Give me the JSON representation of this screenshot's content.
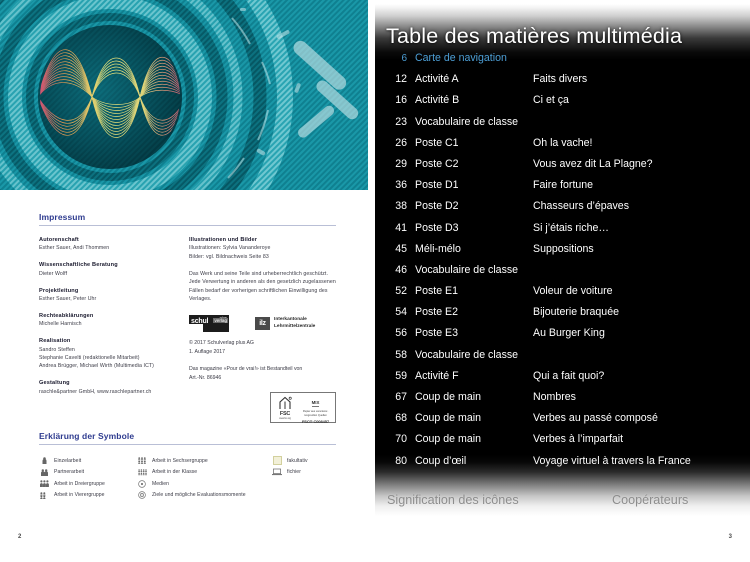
{
  "spread": {
    "left_page_number": "2",
    "right_page_number": "3"
  },
  "left_page": {
    "hero": {
      "alt": "abstract teal concentric circles with coloured sound waves"
    },
    "impressum": {
      "title": "Impressum",
      "column_left": [
        {
          "heading": "Autorenschaft",
          "lines": [
            "Esther Sauer, Andi Thommen"
          ]
        },
        {
          "heading": "Wissenschaftliche Beratung",
          "lines": [
            "Dieter Wolff"
          ]
        },
        {
          "heading": "Projektleitung",
          "lines": [
            "Esther Sauer, Peter Uhr"
          ]
        },
        {
          "heading": "Rechteabklärungen",
          "lines": [
            "Michelle Harnisch"
          ]
        },
        {
          "heading": "Realisation",
          "lines": [
            "Sandro Steffen",
            "Stephanie Cavelti (redaktionelle Mitarbeit)",
            "Andrea Brügger, Michael Wirth (Multimedia ICT)"
          ]
        },
        {
          "heading": "Gestaltung",
          "lines": [
            "raschle&partner GmbH, www.raschlepartner.ch"
          ]
        }
      ],
      "column_right": {
        "heading": "Illustrationen und Bilder",
        "lines": [
          "Illustrationen: Sylvia Vananderoye",
          "Bilder: vgl. Bildnachweis Seite 83"
        ],
        "copyright_notice": "Das Werk und seine Teile sind urheberrechtlich geschützt. Jede Verwertung in anderen als den gesetzlich zugelassenen Fällen bedarf der vorherigen schriftlichen Einwilligung des Verlages.",
        "logos": {
          "schulverlag": {
            "word": "schul",
            "tag": "verlag",
            "plus": "plus"
          },
          "ilz": {
            "mark": "ilz",
            "line1": "Interkantonale",
            "line2": "Lehrmittelzentrale"
          }
        },
        "copyright_lines": [
          "© 2017 Schulverlag plus AG",
          "1. Auflage 2017"
        ],
        "magazine_lines": [
          "Das magazine «Pour de vrai!» ist Bestandteil von",
          "Art.-Nr. 86946"
        ],
        "fsc": {
          "name": "FSC",
          "sub": "www.fsc.org",
          "mix": "MIX",
          "desc_line1": "Papier aus verantwor-",
          "desc_line2": "tungsvollen Quellen",
          "code": "FSC® C008457"
        }
      }
    },
    "symbols": {
      "title": "Erklärung der Symbole",
      "column_1": [
        {
          "icon": "person-single-icon",
          "label": "Einzelarbeit"
        },
        {
          "icon": "person-pair-icon",
          "label": "Partnerarbeit"
        },
        {
          "icon": "person-trio-icon",
          "label": "Arbeit in Dreiergruppe"
        },
        {
          "icon": "person-quad-icon",
          "label": "Arbeit in Vierergruppe"
        }
      ],
      "column_2": [
        {
          "icon": "person-six-icon",
          "label": "Arbeit in Sechsergruppe"
        },
        {
          "icon": "person-class-icon",
          "label": "Arbeit in der Klasse"
        },
        {
          "icon": "media-disc-icon",
          "label": "Medien"
        },
        {
          "icon": "target-circle-icon",
          "label": "Ziele und mögliche Evaluationsmomente"
        }
      ],
      "column_3": [
        {
          "icon": "yellow-square-icon",
          "label": "fakultativ"
        },
        {
          "icon": "laptop-icon",
          "label": "fichier"
        }
      ]
    }
  },
  "right_page": {
    "title": "Table des matières multimédia",
    "entries": [
      {
        "page": "6",
        "label": "Carte de navigation",
        "desc": "",
        "accent": true
      },
      {
        "page": "12",
        "label": "Activité A",
        "desc": "Faits divers",
        "accent": false
      },
      {
        "page": "16",
        "label": "Activité B",
        "desc": "Ci et ça",
        "accent": false
      },
      {
        "page": "23",
        "label": "Vocabulaire de classe",
        "desc": "",
        "accent": false
      },
      {
        "page": "26",
        "label": "Poste C1",
        "desc": "Oh la vache!",
        "accent": false
      },
      {
        "page": "29",
        "label": "Poste C2",
        "desc": "Vous avez dit La Plagne?",
        "accent": false
      },
      {
        "page": "36",
        "label": "Poste D1",
        "desc": "Faire fortune",
        "accent": false
      },
      {
        "page": "38",
        "label": "Poste D2",
        "desc": "Chasseurs d’épaves",
        "accent": false
      },
      {
        "page": "41",
        "label": "Poste D3",
        "desc": "Si j’étais riche…",
        "accent": false
      },
      {
        "page": "45",
        "label": "Méli-mélo",
        "desc": "Suppositions",
        "accent": false
      },
      {
        "page": "46",
        "label": "Vocabulaire de classe",
        "desc": "",
        "accent": false
      },
      {
        "page": "52",
        "label": "Poste E1",
        "desc": "Voleur de voiture",
        "accent": false
      },
      {
        "page": "54",
        "label": "Poste E2",
        "desc": "Bijouterie braquée",
        "accent": false
      },
      {
        "page": "56",
        "label": "Poste E3",
        "desc": "Au Burger King",
        "accent": false
      },
      {
        "page": "58",
        "label": "Vocabulaire de classe",
        "desc": "",
        "accent": false
      },
      {
        "page": "59",
        "label": "Activité F",
        "desc": "Qui a fait quoi?",
        "accent": false
      },
      {
        "page": "67",
        "label": "Coup de main",
        "desc": "Nombres",
        "accent": false
      },
      {
        "page": "68",
        "label": "Coup de main",
        "desc": "Verbes au passé composé",
        "accent": false
      },
      {
        "page": "70",
        "label": "Coup de main",
        "desc": "Verbes à l’imparfait",
        "accent": false
      },
      {
        "page": "80",
        "label": "Coup d’œil",
        "desc": "Voyage virtuel à travers la France",
        "accent": false
      }
    ],
    "footer_left": "Signification des icônes",
    "footer_right": "Coopérateurs"
  },
  "colors": {
    "accent_blue": "#4d9fd6",
    "heading_navy": "#2e3b8f",
    "panel_black": "#000000",
    "hero_teal": "#0e7f8e",
    "footer_gray": "#8d8d8d"
  }
}
